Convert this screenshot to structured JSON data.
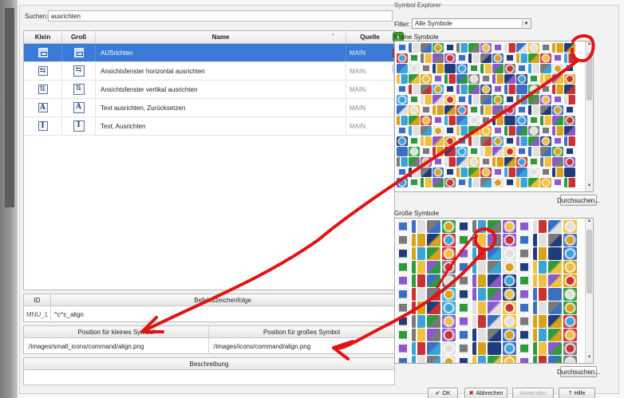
{
  "search": {
    "label": "Suchen:",
    "value": "ausrichten"
  },
  "table": {
    "headers": {
      "klein": "Klein",
      "gross": "Groß",
      "name": "Name",
      "quelle": "Quelle"
    },
    "rows": [
      {
        "name": "AUSrichten",
        "quelle": "MAIN",
        "selected": true,
        "icon": "align-icon"
      },
      {
        "name": "Ansichtsfenster horizontal ausrichten",
        "quelle": "MAIN",
        "selected": false,
        "icon": "viewport-horizontal-align-icon"
      },
      {
        "name": "Ansichtsfenster vertikal ausrichten",
        "quelle": "MAIN",
        "selected": false,
        "icon": "viewport-vertical-align-icon"
      },
      {
        "name": "Text ausrichten, Zurücksetzen",
        "quelle": "MAIN",
        "selected": false,
        "icon": "text-align-reset-icon"
      },
      {
        "name": "Text, Ausrichten",
        "quelle": "MAIN",
        "selected": false,
        "icon": "text-align-icon"
      }
    ]
  },
  "side_buttons": {
    "add": "+",
    "delete": "×",
    "copy": "⎘"
  },
  "command": {
    "id_header": "ID",
    "macro_header": "Befehlszeichenfolge",
    "id_value": "MNU_1",
    "macro_value": "^c^c_align"
  },
  "positions": {
    "small_header": "Position für kleines Symbol",
    "large_header": "Position für großes Symbol",
    "small_value": ":/images/small_icons/command/align.png",
    "large_value": ":/images/icons/command/align.png"
  },
  "description": {
    "header": "Beschreibung",
    "value": ""
  },
  "explorer": {
    "title": "Symbol Explorer",
    "filter_label": "Filter:",
    "filter_value": "Alle Symbole",
    "small_label": "Kleine Symbole",
    "large_label": "Große Symbole",
    "browse_label": "Durchsuchen..."
  },
  "dialog_buttons": {
    "ok": "OK",
    "cancel": "Abbrechen",
    "apply": "Anwenden",
    "help": "Hilfe"
  },
  "colors": {
    "selection": "#3b7ad6",
    "annotation": "#e01414",
    "symbol_palette": [
      "#3a6fc4",
      "#d8a21c",
      "#2e9a3c",
      "#c83232",
      "#7a7a7a",
      "#3aa4d8",
      "#8a5ac8",
      "#e0e0e0",
      "#1f3d7a",
      "#f0c040"
    ]
  }
}
